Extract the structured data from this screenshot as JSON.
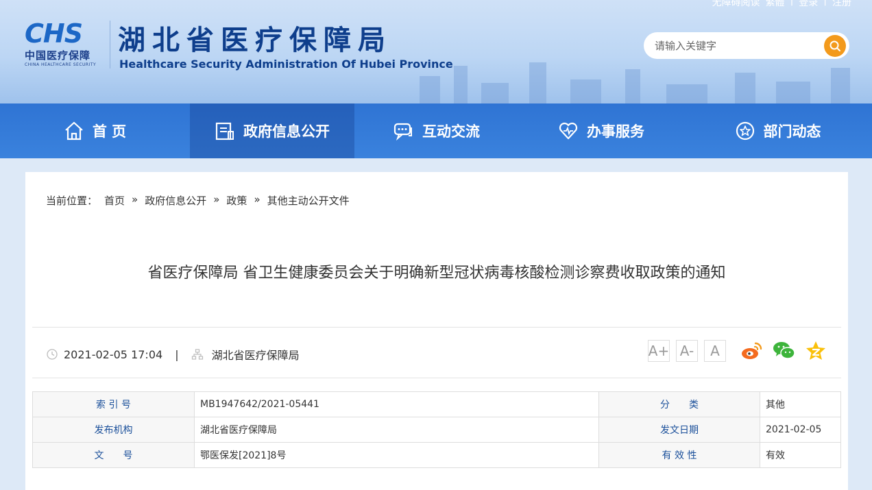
{
  "toplinks": [
    "无障碍阅读",
    "繁體",
    "登录",
    "注册"
  ],
  "logo": {
    "mark": "CHS",
    "cn": "中国医疗保障",
    "en": "CHINA HEALTHCARE SECURITY"
  },
  "site": {
    "title": "湖北省医疗保障局",
    "subtitle": "Healthcare Security Administration Of Hubei Province"
  },
  "search": {
    "placeholder": "请输入关键字"
  },
  "nav": [
    {
      "label": "首 页",
      "icon": "home-icon"
    },
    {
      "label": "政府信息公开",
      "icon": "document-icon"
    },
    {
      "label": "互动交流",
      "icon": "chat-icon"
    },
    {
      "label": "办事服务",
      "icon": "heart-icon"
    },
    {
      "label": "部门动态",
      "icon": "star-icon"
    }
  ],
  "breadcrumb": {
    "prefix": "当前位置：",
    "items": [
      "首页",
      "政府信息公开",
      "政策",
      "其他主动公开文件"
    ],
    "sep": "»"
  },
  "article": {
    "title": "省医疗保障局 省卫生健康委员会关于明确新型冠状病毒核酸检测诊察费收取政策的通知",
    "datetime": "2021-02-05 17:04",
    "source": "湖北省医疗保障局"
  },
  "font_buttons": [
    "A+",
    "A-",
    "A"
  ],
  "info_table": {
    "rows": [
      [
        "索 引 号",
        "MB1947642/2021-05441",
        "分　　类",
        "其他"
      ],
      [
        "发布机构",
        "湖北省医疗保障局",
        "发文日期",
        "2021-02-05"
      ],
      [
        "文　　号",
        "鄂医保发[2021]8号",
        "有 效 性",
        "有效"
      ]
    ]
  },
  "colors": {
    "primary": "#2f74d4",
    "title": "#0e3e8c",
    "search_button": "#f39a1c",
    "label": "#1a4f9a"
  }
}
